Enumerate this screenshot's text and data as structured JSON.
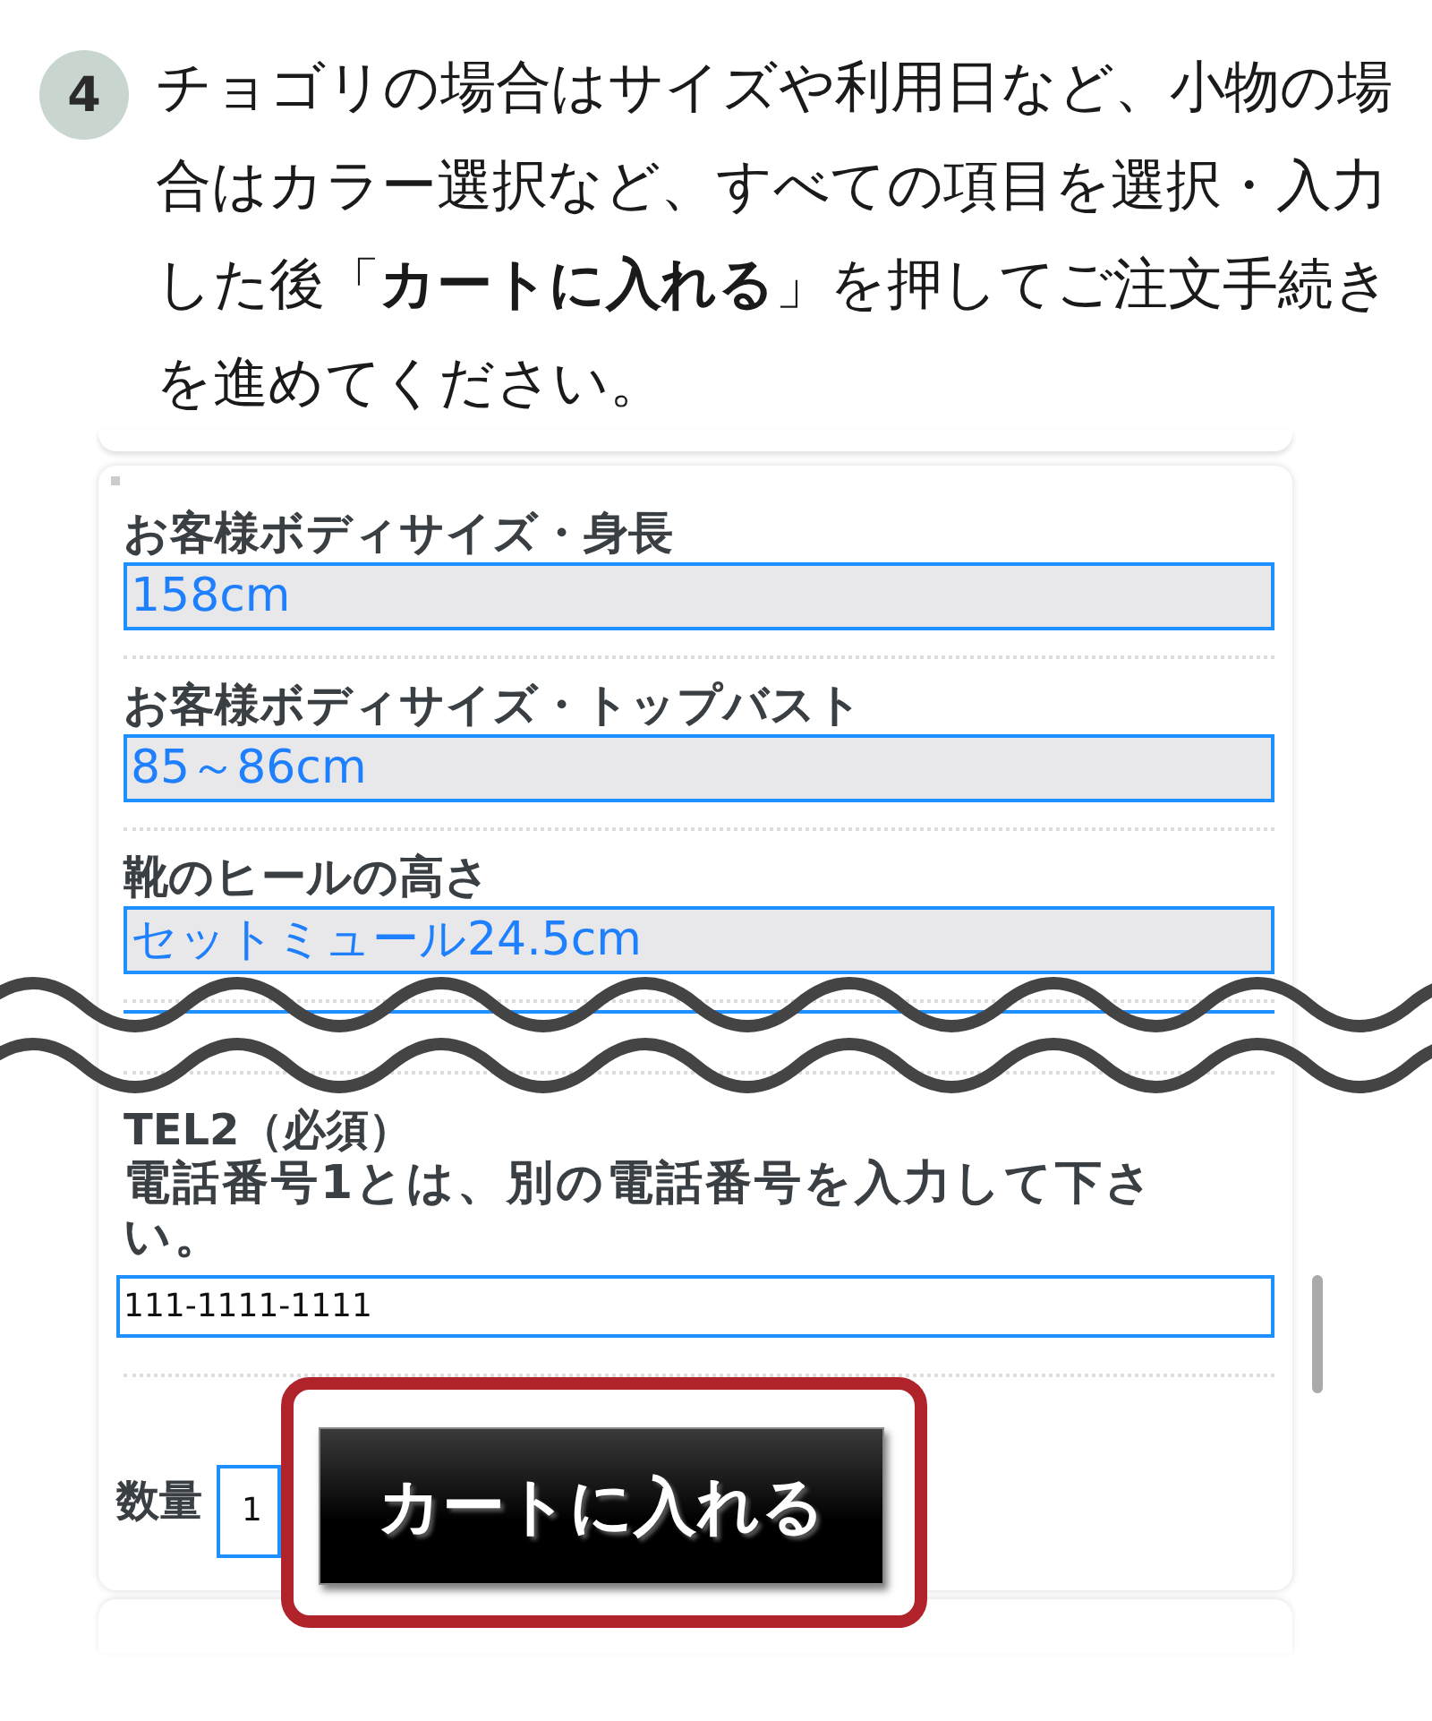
{
  "step": {
    "number": "4",
    "text": "チョゴリの場合はサイズや利用日など、小物の場合はカラー選択など、すべての項目を選択・入力した後「**カートに入れる**」を押してご注文手続きを進めてください。"
  },
  "fields": [
    {
      "label": "お客様ボディサイズ・身長",
      "value": "158cm"
    },
    {
      "label": "お客様ボディサイズ・トップバスト",
      "value": "85～86cm"
    },
    {
      "label": "靴のヒールの高さ",
      "value": "セットミュール24.5cm"
    }
  ],
  "tel_field": {
    "label": "TEL2（必須）",
    "note": "電話番号1とは、別の電話番号を入力して下さい。",
    "value": "111-1111-1111"
  },
  "quantity": {
    "label": "数量",
    "value": "1"
  },
  "cart_button": {
    "label": "カートに入れる",
    "highlighted": true
  }
}
